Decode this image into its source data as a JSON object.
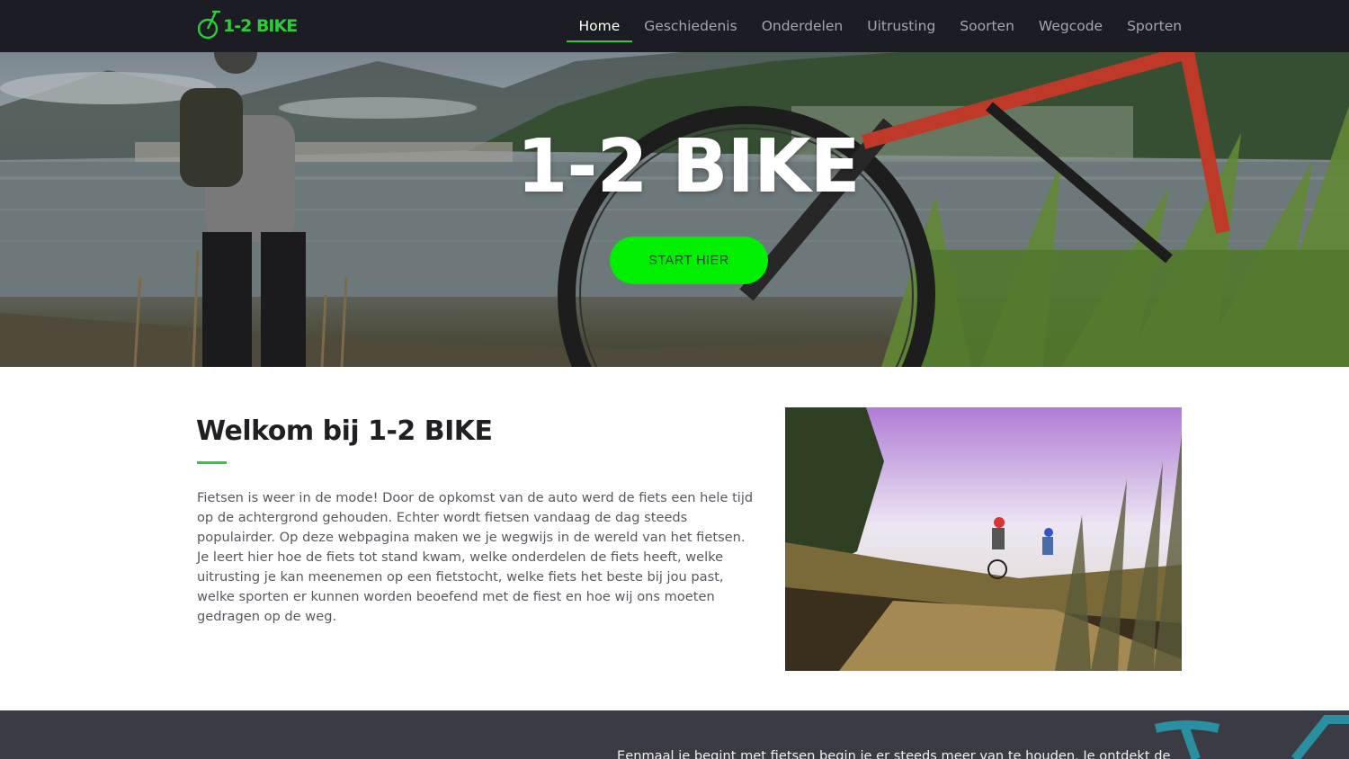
{
  "brand": {
    "logo_text": "1-2 BIKE",
    "accent_color": "#2ecc3a",
    "icon": "bicycle-icon"
  },
  "nav": {
    "items": [
      {
        "label": "Home",
        "active": true
      },
      {
        "label": "Geschiedenis",
        "active": false
      },
      {
        "label": "Onderdelen",
        "active": false
      },
      {
        "label": "Uitrusting",
        "active": false
      },
      {
        "label": "Soorten",
        "active": false
      },
      {
        "label": "Wegcode",
        "active": false
      },
      {
        "label": "Sporten",
        "active": false
      }
    ]
  },
  "hero": {
    "title": "1-2 BIKE",
    "button_label": "START HIER",
    "button_color": "#00ee00"
  },
  "welcome": {
    "title": "Welkom bij 1-2 BIKE",
    "body": "Fietsen is weer in de mode! Door de opkomst van de auto werd de fiets een hele tijd op de achtergrond gehouden. Echter wordt fietsen vandaag de dag steeds populairder. Op deze webpagina maken we je wegwijs in de wereld van het fietsen. Je leert hier hoe de fiets tot stand kwam, welke onderdelen de fiets heeft, welke uitrusting je kan meenemen op een fietstocht, welke fiets het beste bij jou past, welke sporten er kunnen worden beoefend met de fiest en hoe wij ons moeten gedragen op de weg."
  },
  "band": {
    "text": "Eenmaal je begint met fietsen begin je er steeds meer van te houden. Je ontdekt de"
  }
}
